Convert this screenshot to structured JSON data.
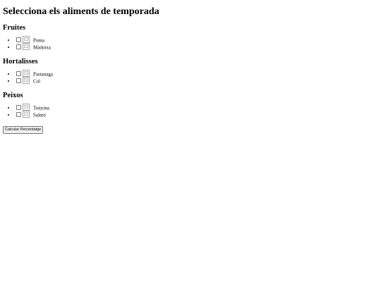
{
  "title": "Selecciona els aliments de temporada",
  "sections": [
    {
      "heading": "Fruites",
      "items": [
        {
          "label": "Poma",
          "checked": false
        },
        {
          "label": "Maduixa",
          "checked": false
        }
      ]
    },
    {
      "heading": "Hortalisses",
      "items": [
        {
          "label": "Pastanaga",
          "checked": false
        },
        {
          "label": "Col",
          "checked": false
        }
      ]
    },
    {
      "heading": "Peixos",
      "items": [
        {
          "label": "Tonyina",
          "checked": false
        },
        {
          "label": "Salmó",
          "checked": false
        }
      ]
    }
  ],
  "button": {
    "label": "Calcular Percentatge"
  }
}
